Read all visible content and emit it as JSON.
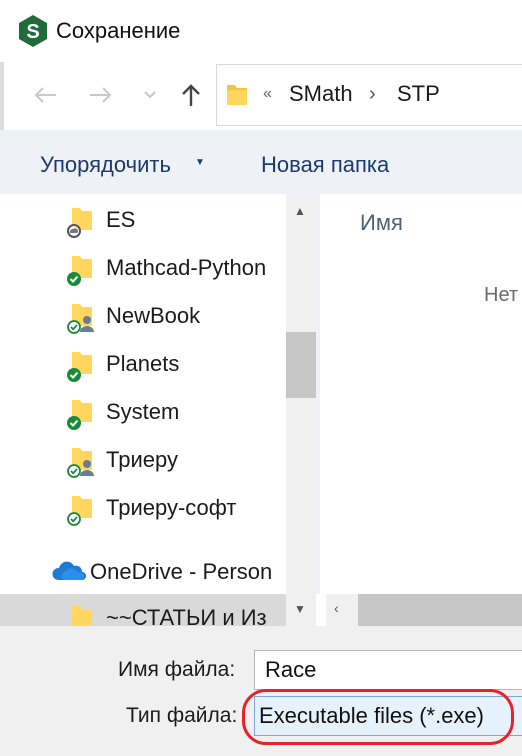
{
  "window": {
    "title": "Сохранение"
  },
  "address_bar": {
    "overflow": "«",
    "breadcrumbs": [
      "SMath",
      "STP"
    ]
  },
  "toolbar": {
    "organize_label": "Упорядочить",
    "new_folder_label": "Новая папка"
  },
  "nav_tree": [
    {
      "label": "ES",
      "icon": "folder-cloud-icon"
    },
    {
      "label": "Mathcad-Python",
      "icon": "folder-synced-icon"
    },
    {
      "label": "NewBook",
      "icon": "folder-shared-icon"
    },
    {
      "label": "Planets",
      "icon": "folder-synced-icon"
    },
    {
      "label": "System",
      "icon": "folder-synced-icon"
    },
    {
      "label": "Триеру",
      "icon": "folder-shared-icon"
    },
    {
      "label": "Триеру-софт",
      "icon": "folder-available-icon"
    },
    {
      "label": "OneDrive - Person",
      "icon": "onedrive-cloud-icon"
    },
    {
      "label": "~~СТАТЬИ и Из",
      "icon": "folder-icon",
      "selected": true
    }
  ],
  "content": {
    "column_name": "Имя",
    "empty_message": "Нет"
  },
  "form": {
    "filename_label": "Имя файла:",
    "filename_value": "Race",
    "filetype_label": "Тип файла:",
    "filetype_value": "Executable files (*.exe)"
  },
  "colors": {
    "accent": "#1b3a6e",
    "highlight": "#e8222a",
    "sync_green": "#1a8a3a"
  }
}
